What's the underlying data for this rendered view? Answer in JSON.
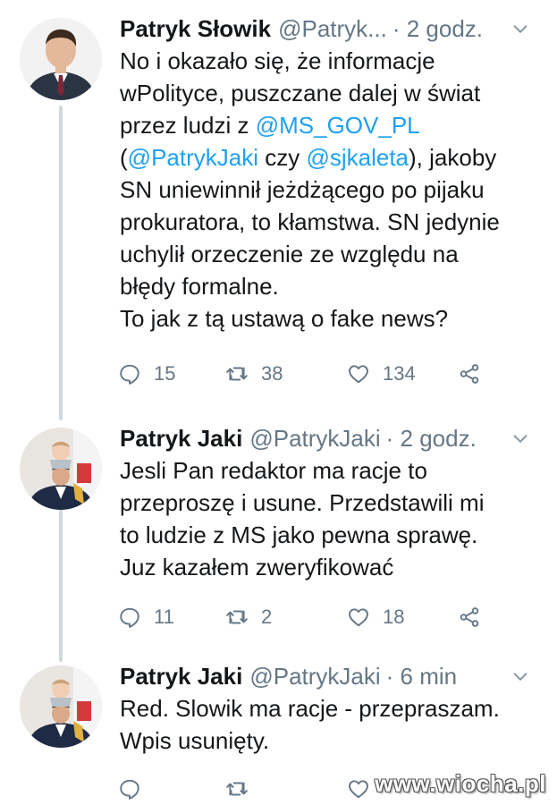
{
  "tweets": [
    {
      "name": "Patryk Słowik",
      "handle": "@Patryk...",
      "time": "· 2 godz.",
      "lines": [
        [
          {
            "text": "No i okazało się, że informacje"
          }
        ],
        [
          {
            "text": "wPolityce, puszczane dalej w świat"
          }
        ],
        [
          {
            "text": "przez ludzi z "
          },
          {
            "text": "@MS_GOV_PL",
            "mention": true
          }
        ],
        [
          {
            "text": "("
          },
          {
            "text": "@PatrykJaki",
            "mention": true
          },
          {
            "text": " czy "
          },
          {
            "text": "@sjkaleta",
            "mention": true
          },
          {
            "text": "), jakoby"
          }
        ],
        [
          {
            "text": "SN uniewinnił jeżdżącego po pijaku"
          }
        ],
        [
          {
            "text": "prokuratora, to kłamstwa. SN jedynie"
          }
        ],
        [
          {
            "text": "uchylił orzeczenie ze względu na"
          }
        ],
        [
          {
            "text": "błędy formalne."
          }
        ],
        [
          {
            "text": "To jak z tą ustawą o fake news?"
          }
        ]
      ],
      "replies": "15",
      "retweets": "38",
      "likes": "134"
    },
    {
      "name": "Patryk Jaki",
      "handle": "@PatrykJaki",
      "time": "· 2 godz.",
      "lines": [
        [
          {
            "text": "Jesli Pan redaktor ma racje to"
          }
        ],
        [
          {
            "text": "przeproszę i usune. Przedstawili mi"
          }
        ],
        [
          {
            "text": "to ludzie z MS jako pewna sprawę."
          }
        ],
        [
          {
            "text": "Juz kazałem zweryfikować"
          }
        ]
      ],
      "replies": "11",
      "retweets": "2",
      "likes": "18"
    },
    {
      "name": "Patryk Jaki",
      "handle": "@PatrykJaki",
      "time": "· 6 min",
      "lines": [
        [
          {
            "text": "Red. Slowik ma racje - przepraszam."
          }
        ],
        [
          {
            "text": "Wpis usunięty."
          }
        ]
      ],
      "replies": "",
      "retweets": "",
      "likes": ""
    }
  ],
  "watermark": "www.wiocha.pl",
  "colors": {
    "text": "#14171a",
    "secondary": "#657786",
    "mention": "#1da1f2",
    "thread_line": "#cfd9de"
  },
  "icons": [
    "reply-icon",
    "retweet-icon",
    "like-icon",
    "share-icon",
    "chevron-down-icon"
  ]
}
